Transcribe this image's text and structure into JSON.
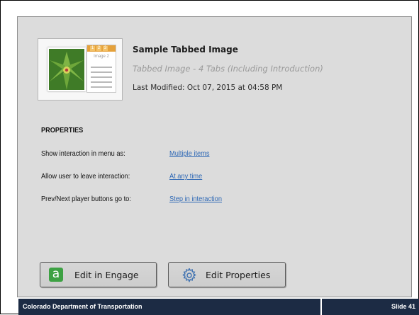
{
  "thumbnail": {
    "tabs": [
      "1",
      "2",
      "3"
    ],
    "doc_label": "Image 2"
  },
  "interaction": {
    "title": "Sample Tabbed Image",
    "subtitle": "Tabbed Image - 4 Tabs (Including Introduction)",
    "last_modified": "Last Modified: Oct 07, 2015 at 04:58 PM"
  },
  "properties": {
    "heading": "PROPERTIES",
    "rows": [
      {
        "label": "Show interaction in menu as:",
        "value": "Multiple items"
      },
      {
        "label": "Allow user to leave interaction:",
        "value": "At any time"
      },
      {
        "label": "Prev/Next player buttons go to:",
        "value": "Step in interaction"
      }
    ]
  },
  "buttons": {
    "edit_engage": "Edit in Engage",
    "edit_properties": "Edit Properties",
    "engage_glyph": "a"
  },
  "footer": {
    "left": "Colorado Department of Transportation",
    "right": "Slide 41"
  },
  "colors": {
    "panel_bg": "#dcdcdc",
    "link": "#2e68b5",
    "footer_bg": "#1c2b44",
    "engage_green": "#3da143"
  }
}
